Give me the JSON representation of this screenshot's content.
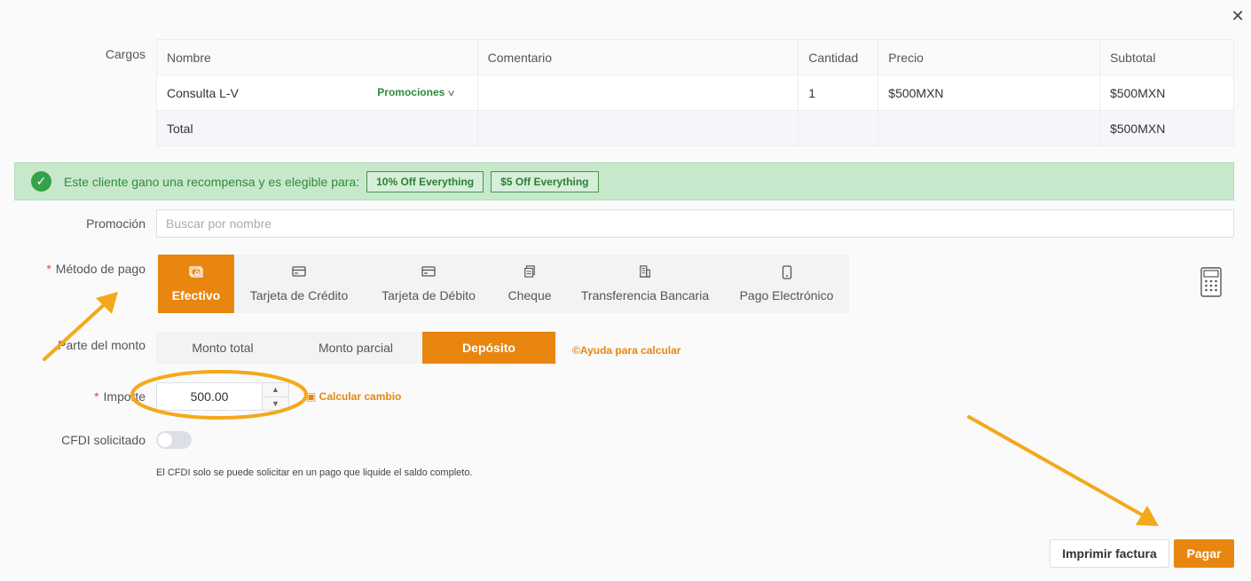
{
  "dialog": {
    "close_glyph": "✕"
  },
  "charges": {
    "label": "Cargos",
    "columns": [
      "Nombre",
      "Comentario",
      "Cantidad",
      "Precio",
      "Subtotal"
    ],
    "rows": [
      {
        "name": "Consulta L-V",
        "promo_label": "Promociones",
        "comment": "",
        "qty": "1",
        "price": "$500MXN",
        "subtotal": "$500MXN"
      }
    ],
    "total_label": "Total",
    "total_value": "$500MXN"
  },
  "reward": {
    "text": "Este cliente gano una recompensa y es elegible para:",
    "tags": [
      "10% Off Everything",
      "$5 Off Everything"
    ]
  },
  "promotion": {
    "label": "Promoción",
    "placeholder": "Buscar por nombre"
  },
  "payment_method": {
    "label": "Método de pago",
    "required": "*",
    "options": [
      "Efectivo",
      "Tarjeta de Crédito",
      "Tarjeta de Débito",
      "Cheque",
      "Transferencia Bancaria",
      "Pago Electrónico"
    ],
    "icons": [
      "cash-icon",
      "credit-card-icon",
      "debit-card-icon",
      "check-icon",
      "bank-icon",
      "mobile-payment-icon"
    ],
    "selected": "Efectivo"
  },
  "amount_part": {
    "label": "Parte del monto",
    "options": [
      "Monto total",
      "Monto parcial",
      "Depósito"
    ],
    "selected": "Depósito",
    "help_link": "©Ayuda para calcular"
  },
  "importe": {
    "label": "Importe",
    "required": "*",
    "value": "500.00",
    "calc_change": "Calcular cambio"
  },
  "cfdi": {
    "label": "CFDI solicitado",
    "enabled": false,
    "note": "El CFDI solo se puede solicitar en un pago que liquide el saldo completo."
  },
  "footer": {
    "print_label": "Imprimir factura",
    "pay_label": "Pagar"
  },
  "colors": {
    "accent": "#e8860f",
    "success": "#35a14a",
    "annotation": "#f4a81c"
  }
}
